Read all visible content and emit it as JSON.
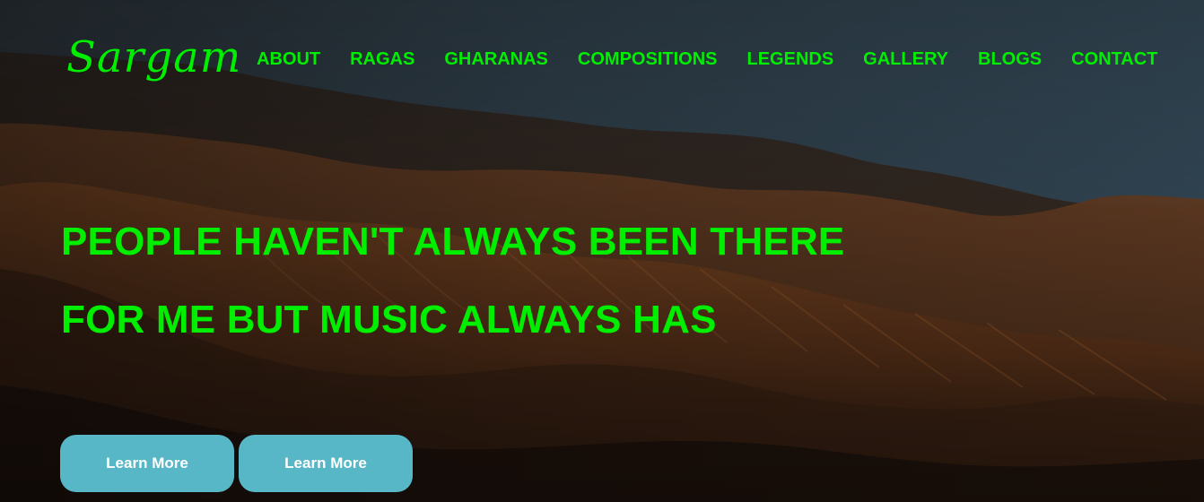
{
  "brand": {
    "logo": "Sargam"
  },
  "nav": {
    "items": [
      {
        "label": "ABOUT"
      },
      {
        "label": "RAGAS"
      },
      {
        "label": "GHARANAS"
      },
      {
        "label": "COMPOSITIONS"
      },
      {
        "label": "LEGENDS"
      },
      {
        "label": "GALLERY"
      },
      {
        "label": "BLOGS"
      },
      {
        "label": "CONTACT"
      }
    ]
  },
  "hero": {
    "headline": "PEOPLE HAVEN'T ALWAYS BEEN THERE FOR ME BUT MUSIC ALWAYS HAS",
    "buttons": [
      {
        "label": "Learn More"
      },
      {
        "label": "Learn More"
      }
    ]
  },
  "colors": {
    "accent_green": "#00ee00",
    "button_teal": "#58b7c6"
  }
}
